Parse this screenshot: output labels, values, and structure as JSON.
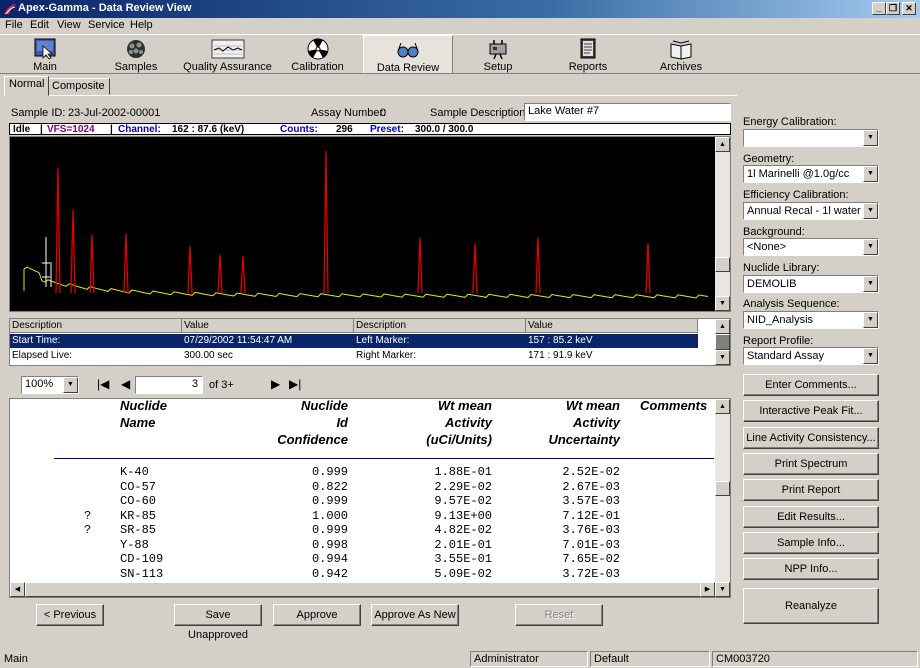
{
  "window": {
    "title": "Apex-Gamma - Data Review View"
  },
  "menu": [
    "File",
    "Edit",
    "View",
    "Service",
    "Help"
  ],
  "toolbar": [
    {
      "label": "Main",
      "icon": "main-icon"
    },
    {
      "label": "Samples",
      "icon": "samples-icon"
    },
    {
      "label": "Quality Assurance",
      "icon": "quality-assurance-icon"
    },
    {
      "label": "Calibration",
      "icon": "calibration-icon"
    },
    {
      "label": "Data Review",
      "icon": "data-review-icon",
      "active": true
    },
    {
      "label": "Setup",
      "icon": "setup-icon"
    },
    {
      "label": "Reports",
      "icon": "reports-icon"
    },
    {
      "label": "Archives",
      "icon": "archives-icon"
    }
  ],
  "tabs": [
    "Normal",
    "Composite"
  ],
  "sample": {
    "id_label": "Sample ID:",
    "id_value": "23-Jul-2002-00001",
    "assay_label": "Assay Number:",
    "assay_value": "0",
    "desc_label": "Sample Description:",
    "desc_value": "Lake Water #7"
  },
  "status_strip": {
    "state": "Idle",
    "vfs": "VFS=1024",
    "channel": "Channel:",
    "channel_value": "162 : 87.6 (keV)",
    "counts": "Counts:",
    "counts_value": "296",
    "preset": "Preset:",
    "preset_value": "300.0 / 300.0"
  },
  "spectrum": {
    "baseline_color": "#e8e800",
    "peak_color": "#e00000",
    "peaks": [
      {
        "channel": 48,
        "height": 0.88
      },
      {
        "channel": 63,
        "height": 0.58
      },
      {
        "channel": 82,
        "height": 0.4
      },
      {
        "channel": 116,
        "height": 0.41
      },
      {
        "channel": 180,
        "height": 0.32
      },
      {
        "channel": 210,
        "height": 0.26
      },
      {
        "channel": 233,
        "height": 0.25
      },
      {
        "channel": 316,
        "height": 1.0
      },
      {
        "channel": 410,
        "height": 0.38
      },
      {
        "channel": 465,
        "height": 0.34
      },
      {
        "channel": 528,
        "height": 0.38
      },
      {
        "channel": 638,
        "height": 0.34
      }
    ]
  },
  "info_grid": {
    "headers": [
      "Description",
      "Value",
      "Description",
      "Value"
    ],
    "rows": [
      [
        "Start Time:",
        "07/29/2002 11:54:47 AM",
        "Left Marker:",
        "157   : 85.2 keV"
      ],
      [
        "Elapsed Live:",
        "300.00 sec",
        "Right Marker:",
        "171   : 91.9 keV"
      ]
    ]
  },
  "report_nav": {
    "zoom": "100%",
    "page": "3",
    "of_pages": "of 3+"
  },
  "report": {
    "headers": [
      "Nuclide\nName",
      "Nuclide\nId\nConfidence",
      "Wt mean\nActivity\n(uCi/Units)",
      "Wt mean\nActivity\nUncertainty",
      "Comments"
    ],
    "rows": [
      {
        "flag": "",
        "nuclide": "K-40",
        "conf": "0.999",
        "activity": "1.88E-01",
        "unc": "2.52E-02"
      },
      {
        "flag": "",
        "nuclide": "CO-57",
        "conf": "0.822",
        "activity": "2.29E-02",
        "unc": "2.67E-03"
      },
      {
        "flag": "",
        "nuclide": "CO-60",
        "conf": "0.999",
        "activity": "9.57E-02",
        "unc": "3.57E-03"
      },
      {
        "flag": "?",
        "nuclide": "KR-85",
        "conf": "1.000",
        "activity": "9.13E+00",
        "unc": "7.12E-01"
      },
      {
        "flag": "?",
        "nuclide": "SR-85",
        "conf": "0.999",
        "activity": "4.82E-02",
        "unc": "3.76E-03"
      },
      {
        "flag": "",
        "nuclide": "Y-88",
        "conf": "0.998",
        "activity": "2.01E-01",
        "unc": "7.01E-03"
      },
      {
        "flag": "",
        "nuclide": "CD-109",
        "conf": "0.994",
        "activity": "3.55E-01",
        "unc": "7.65E-02"
      },
      {
        "flag": "",
        "nuclide": "SN-113",
        "conf": "0.942",
        "activity": "5.09E-02",
        "unc": "3.72E-03"
      }
    ]
  },
  "bottom_buttons": {
    "previous": "< Previous",
    "save_unapproved": "Save Unapproved",
    "approve": "Approve",
    "approve_as_new": "Approve As New",
    "reset": "Reset"
  },
  "right_panel": {
    "energy_cal_label": "Energy Calibration:",
    "energy_cal_value": "",
    "geometry_label": "Geometry:",
    "geometry_value": "1l Marinelli @1.0g/cc",
    "eff_cal_label": "Efficiency Calibration:",
    "eff_cal_value": "Annual Recal - 1l water",
    "background_label": "Background:",
    "background_value": "<None>",
    "nuclide_lib_label": "Nuclide Library:",
    "nuclide_lib_value": "DEMOLIB",
    "analysis_seq_label": "Analysis Sequence:",
    "analysis_seq_value": "NID_Analysis",
    "report_profile_label": "Report Profile:",
    "report_profile_value": "Standard Assay",
    "buttons": [
      "Enter Comments...",
      "Interactive Peak Fit...",
      "Line Activity Consistency...",
      "Print Spectrum",
      "Print Report",
      "Edit Results...",
      "Sample Info...",
      "NPP Info..."
    ],
    "reanalyze": "Reanalyze"
  },
  "statusbar": {
    "main": "Main",
    "user": "Administrator",
    "profile": "Default",
    "code": "CM003720"
  }
}
